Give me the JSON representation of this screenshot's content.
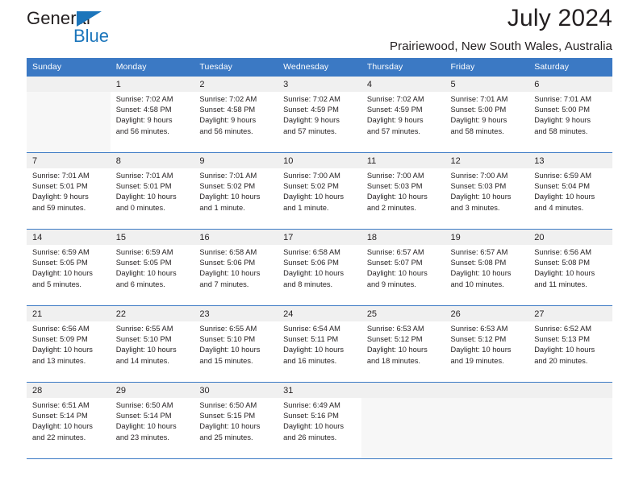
{
  "logo": {
    "primary_text": "General",
    "secondary_text": "Blue",
    "triangle_color": "#1b75bb"
  },
  "header": {
    "title": "July 2024",
    "subtitle": "Prairiewood, New South Wales, Australia"
  },
  "theme": {
    "header_bg": "#3b79c4",
    "header_text": "#ffffff",
    "date_band_bg": "#f0f0f0",
    "body_text": "#231f20"
  },
  "weekdays": [
    "Sunday",
    "Monday",
    "Tuesday",
    "Wednesday",
    "Thursday",
    "Friday",
    "Saturday"
  ],
  "weeks": [
    [
      {
        "day": "",
        "lines": []
      },
      {
        "day": "1",
        "lines": [
          "Sunrise: 7:02 AM",
          "Sunset: 4:58 PM",
          "Daylight: 9 hours",
          "and 56 minutes."
        ]
      },
      {
        "day": "2",
        "lines": [
          "Sunrise: 7:02 AM",
          "Sunset: 4:58 PM",
          "Daylight: 9 hours",
          "and 56 minutes."
        ]
      },
      {
        "day": "3",
        "lines": [
          "Sunrise: 7:02 AM",
          "Sunset: 4:59 PM",
          "Daylight: 9 hours",
          "and 57 minutes."
        ]
      },
      {
        "day": "4",
        "lines": [
          "Sunrise: 7:02 AM",
          "Sunset: 4:59 PM",
          "Daylight: 9 hours",
          "and 57 minutes."
        ]
      },
      {
        "day": "5",
        "lines": [
          "Sunrise: 7:01 AM",
          "Sunset: 5:00 PM",
          "Daylight: 9 hours",
          "and 58 minutes."
        ]
      },
      {
        "day": "6",
        "lines": [
          "Sunrise: 7:01 AM",
          "Sunset: 5:00 PM",
          "Daylight: 9 hours",
          "and 58 minutes."
        ]
      }
    ],
    [
      {
        "day": "7",
        "lines": [
          "Sunrise: 7:01 AM",
          "Sunset: 5:01 PM",
          "Daylight: 9 hours",
          "and 59 minutes."
        ]
      },
      {
        "day": "8",
        "lines": [
          "Sunrise: 7:01 AM",
          "Sunset: 5:01 PM",
          "Daylight: 10 hours",
          "and 0 minutes."
        ]
      },
      {
        "day": "9",
        "lines": [
          "Sunrise: 7:01 AM",
          "Sunset: 5:02 PM",
          "Daylight: 10 hours",
          "and 1 minute."
        ]
      },
      {
        "day": "10",
        "lines": [
          "Sunrise: 7:00 AM",
          "Sunset: 5:02 PM",
          "Daylight: 10 hours",
          "and 1 minute."
        ]
      },
      {
        "day": "11",
        "lines": [
          "Sunrise: 7:00 AM",
          "Sunset: 5:03 PM",
          "Daylight: 10 hours",
          "and 2 minutes."
        ]
      },
      {
        "day": "12",
        "lines": [
          "Sunrise: 7:00 AM",
          "Sunset: 5:03 PM",
          "Daylight: 10 hours",
          "and 3 minutes."
        ]
      },
      {
        "day": "13",
        "lines": [
          "Sunrise: 6:59 AM",
          "Sunset: 5:04 PM",
          "Daylight: 10 hours",
          "and 4 minutes."
        ]
      }
    ],
    [
      {
        "day": "14",
        "lines": [
          "Sunrise: 6:59 AM",
          "Sunset: 5:05 PM",
          "Daylight: 10 hours",
          "and 5 minutes."
        ]
      },
      {
        "day": "15",
        "lines": [
          "Sunrise: 6:59 AM",
          "Sunset: 5:05 PM",
          "Daylight: 10 hours",
          "and 6 minutes."
        ]
      },
      {
        "day": "16",
        "lines": [
          "Sunrise: 6:58 AM",
          "Sunset: 5:06 PM",
          "Daylight: 10 hours",
          "and 7 minutes."
        ]
      },
      {
        "day": "17",
        "lines": [
          "Sunrise: 6:58 AM",
          "Sunset: 5:06 PM",
          "Daylight: 10 hours",
          "and 8 minutes."
        ]
      },
      {
        "day": "18",
        "lines": [
          "Sunrise: 6:57 AM",
          "Sunset: 5:07 PM",
          "Daylight: 10 hours",
          "and 9 minutes."
        ]
      },
      {
        "day": "19",
        "lines": [
          "Sunrise: 6:57 AM",
          "Sunset: 5:08 PM",
          "Daylight: 10 hours",
          "and 10 minutes."
        ]
      },
      {
        "day": "20",
        "lines": [
          "Sunrise: 6:56 AM",
          "Sunset: 5:08 PM",
          "Daylight: 10 hours",
          "and 11 minutes."
        ]
      }
    ],
    [
      {
        "day": "21",
        "lines": [
          "Sunrise: 6:56 AM",
          "Sunset: 5:09 PM",
          "Daylight: 10 hours",
          "and 13 minutes."
        ]
      },
      {
        "day": "22",
        "lines": [
          "Sunrise: 6:55 AM",
          "Sunset: 5:10 PM",
          "Daylight: 10 hours",
          "and 14 minutes."
        ]
      },
      {
        "day": "23",
        "lines": [
          "Sunrise: 6:55 AM",
          "Sunset: 5:10 PM",
          "Daylight: 10 hours",
          "and 15 minutes."
        ]
      },
      {
        "day": "24",
        "lines": [
          "Sunrise: 6:54 AM",
          "Sunset: 5:11 PM",
          "Daylight: 10 hours",
          "and 16 minutes."
        ]
      },
      {
        "day": "25",
        "lines": [
          "Sunrise: 6:53 AM",
          "Sunset: 5:12 PM",
          "Daylight: 10 hours",
          "and 18 minutes."
        ]
      },
      {
        "day": "26",
        "lines": [
          "Sunrise: 6:53 AM",
          "Sunset: 5:12 PM",
          "Daylight: 10 hours",
          "and 19 minutes."
        ]
      },
      {
        "day": "27",
        "lines": [
          "Sunrise: 6:52 AM",
          "Sunset: 5:13 PM",
          "Daylight: 10 hours",
          "and 20 minutes."
        ]
      }
    ],
    [
      {
        "day": "28",
        "lines": [
          "Sunrise: 6:51 AM",
          "Sunset: 5:14 PM",
          "Daylight: 10 hours",
          "and 22 minutes."
        ]
      },
      {
        "day": "29",
        "lines": [
          "Sunrise: 6:50 AM",
          "Sunset: 5:14 PM",
          "Daylight: 10 hours",
          "and 23 minutes."
        ]
      },
      {
        "day": "30",
        "lines": [
          "Sunrise: 6:50 AM",
          "Sunset: 5:15 PM",
          "Daylight: 10 hours",
          "and 25 minutes."
        ]
      },
      {
        "day": "31",
        "lines": [
          "Sunrise: 6:49 AM",
          "Sunset: 5:16 PM",
          "Daylight: 10 hours",
          "and 26 minutes."
        ]
      },
      {
        "day": "",
        "lines": []
      },
      {
        "day": "",
        "lines": []
      },
      {
        "day": "",
        "lines": []
      }
    ]
  ]
}
